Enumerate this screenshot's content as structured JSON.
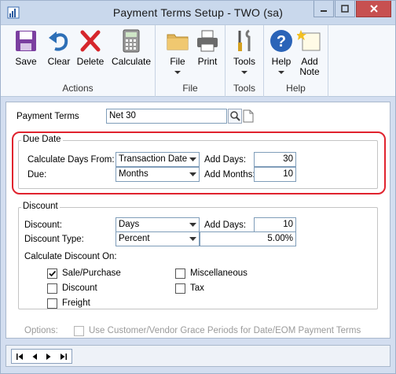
{
  "window": {
    "title": "Payment Terms Setup  -  TWO (sa)"
  },
  "ribbon": {
    "groups": [
      {
        "label": "Actions",
        "buttons": [
          "Save",
          "Clear",
          "Delete",
          "Calculate"
        ]
      },
      {
        "label": "File",
        "buttons": [
          "File",
          "Print"
        ]
      },
      {
        "label": "Tools",
        "buttons": [
          "Tools"
        ]
      },
      {
        "label": "Help",
        "buttons": [
          "Help",
          "Add\nNote"
        ]
      }
    ],
    "save": "Save",
    "clear": "Clear",
    "delete": "Delete",
    "calculate": "Calculate",
    "actions_label": "Actions",
    "file": "File",
    "print": "Print",
    "file_label": "File",
    "tools": "Tools",
    "tools_label": "Tools",
    "help": "Help",
    "add_note_line1": "Add",
    "add_note_line2": "Note",
    "help_label": "Help"
  },
  "form": {
    "payment_terms_label": "Payment Terms",
    "payment_terms_value": "Net 30",
    "due_date": {
      "title": "Due Date",
      "calc_days_from_label": "Calculate Days From:",
      "calc_days_from_value": "Transaction Date",
      "add_days_label": "Add Days:",
      "add_days_value": "30",
      "due_label": "Due:",
      "due_value": "Months",
      "add_months_label": "Add Months:",
      "add_months_value": "10"
    },
    "discount": {
      "title": "Discount",
      "discount_label": "Discount:",
      "discount_value": "Days",
      "add_days_label": "Add Days:",
      "add_days_value": "10",
      "type_label": "Discount Type:",
      "type_value": "Percent",
      "percent_value": "5.00%",
      "calc_on_label": "Calculate Discount On:",
      "options": [
        {
          "label": "Sale/Purchase",
          "checked": true
        },
        {
          "label": "Discount",
          "checked": false
        },
        {
          "label": "Freight",
          "checked": false
        },
        {
          "label": "Miscellaneous",
          "checked": false
        },
        {
          "label": "Tax",
          "checked": false
        }
      ]
    },
    "options_label": "Options:",
    "grace_period_label": "Use Customer/Vendor Grace Periods for Date/EOM Payment Terms",
    "grace_period_checked": false
  },
  "colors": {
    "highlight": "#e0232e",
    "window_bg": "#d3def0",
    "ribbon_bg": "#f5f8fc"
  }
}
